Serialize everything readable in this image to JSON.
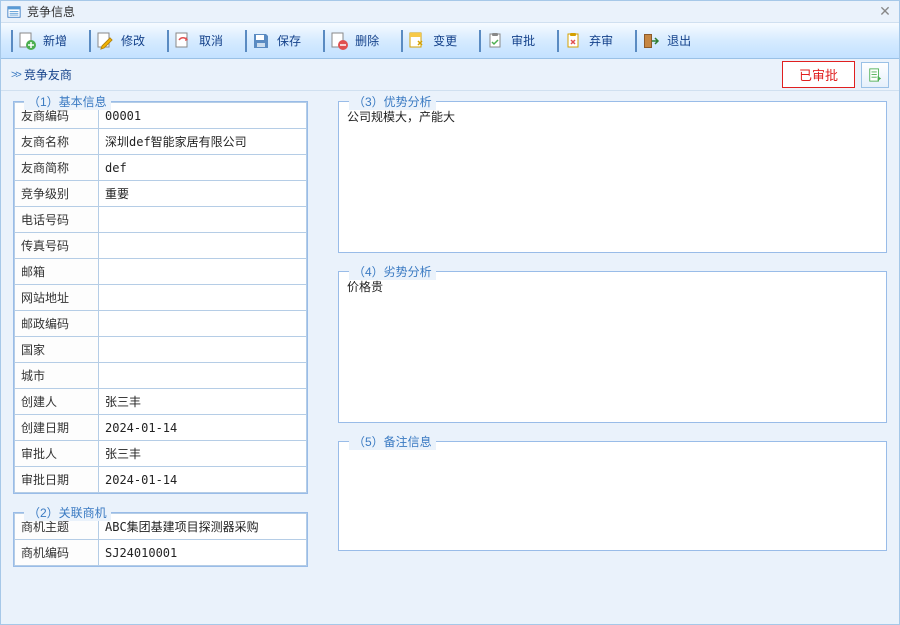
{
  "window": {
    "title": "竞争信息"
  },
  "toolbar": [
    {
      "id": "new",
      "label": "新增"
    },
    {
      "id": "edit",
      "label": "修改"
    },
    {
      "id": "cancel",
      "label": "取消"
    },
    {
      "id": "save",
      "label": "保存"
    },
    {
      "id": "delete",
      "label": "删除"
    },
    {
      "id": "change",
      "label": "变更"
    },
    {
      "id": "approve",
      "label": "审批"
    },
    {
      "id": "unapprove",
      "label": "弃审"
    },
    {
      "id": "exit",
      "label": "退出"
    }
  ],
  "subhead": {
    "title": "竞争友商",
    "status": "已审批"
  },
  "sections": {
    "s1": {
      "title": "（1）基本信息",
      "rows": [
        {
          "k": "友商编码",
          "v": "00001"
        },
        {
          "k": "友商名称",
          "v": "深圳def智能家居有限公司"
        },
        {
          "k": "友商简称",
          "v": "def"
        },
        {
          "k": "竞争级别",
          "v": "重要"
        },
        {
          "k": "电话号码",
          "v": ""
        },
        {
          "k": "传真号码",
          "v": ""
        },
        {
          "k": "邮箱",
          "v": ""
        },
        {
          "k": "网站地址",
          "v": ""
        },
        {
          "k": "邮政编码",
          "v": ""
        },
        {
          "k": "国家",
          "v": ""
        },
        {
          "k": "城市",
          "v": ""
        },
        {
          "k": "创建人",
          "v": "张三丰"
        },
        {
          "k": "创建日期",
          "v": "2024-01-14"
        },
        {
          "k": "审批人",
          "v": "张三丰"
        },
        {
          "k": "审批日期",
          "v": "2024-01-14"
        }
      ]
    },
    "s2": {
      "title": "（2）关联商机",
      "rows": [
        {
          "k": "商机主题",
          "v": "ABC集团基建项目探测器采购"
        },
        {
          "k": "商机编码",
          "v": "SJ24010001"
        }
      ]
    },
    "s3": {
      "title": "（3）优势分析",
      "text": "公司规模大，产能大"
    },
    "s4": {
      "title": "（4）劣势分析",
      "text": "价格贵"
    },
    "s5": {
      "title": "（5）备注信息",
      "text": ""
    }
  }
}
